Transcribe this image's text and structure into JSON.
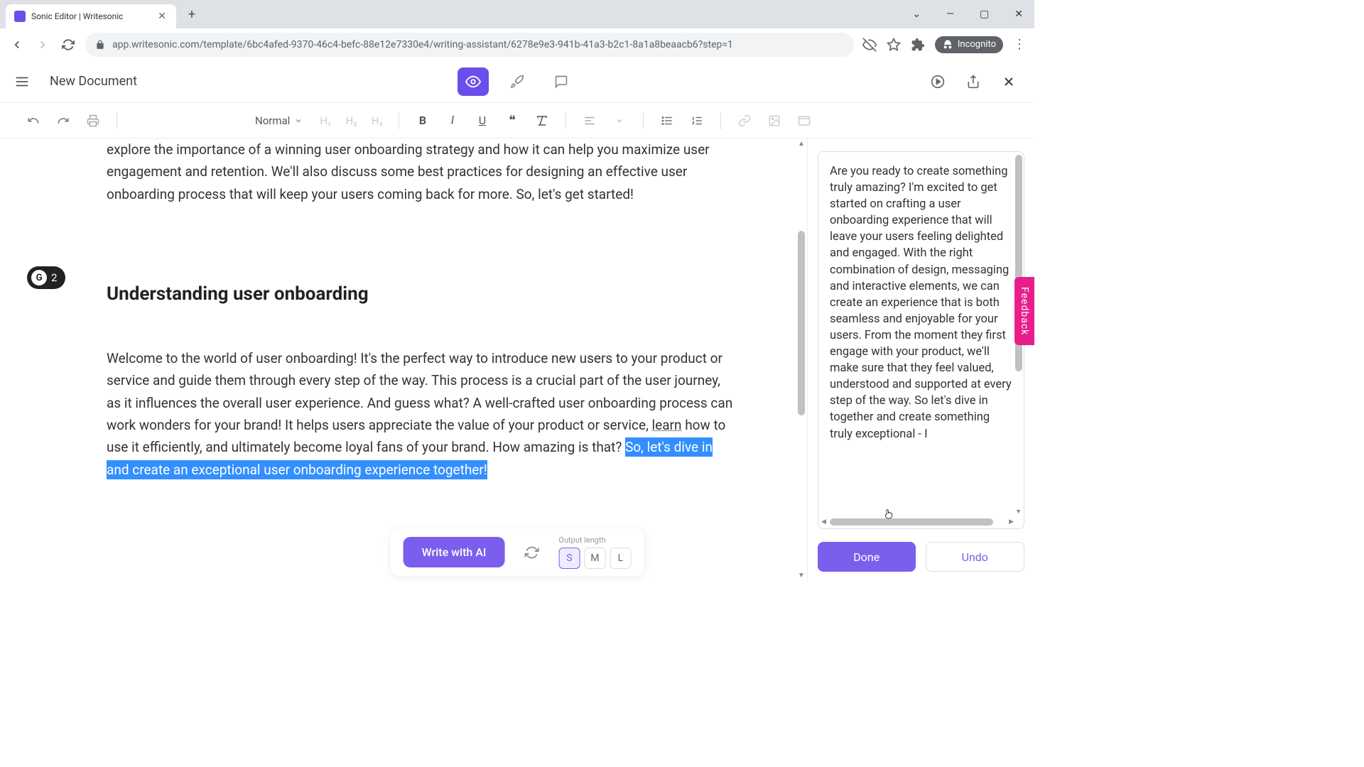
{
  "browser": {
    "tab_title": "Sonic Editor | Writesonic",
    "url": "app.writesonic.com/template/6bc4afed-9370-46c4-befc-88e12e7330e4/writing-assistant/6278e9e3-941b-41a3-b2c1-8a1a8beaacb6?step=1",
    "incognito_label": "Incognito"
  },
  "header": {
    "doc_title": "New Document"
  },
  "toolbar": {
    "style_select": "Normal",
    "h1": "H₁",
    "h2": "H₂",
    "h3": "H₃"
  },
  "editor": {
    "para1": "explore the importance of a winning user onboarding strategy and how it can help you maximize user engagement and retention. We'll also discuss some best practices for designing an effective user onboarding process that will keep your users coming back for more. So, let's get started!",
    "heading": "Understanding user onboarding",
    "para2_a": "Welcome to the world of user onboarding! It's the perfect way to introduce new users to your product or service and guide them through every step of the way. This process is a crucial part of the user journey, as it influences the overall user experience. And guess what? A well-crafted user onboarding process can work wonders for your brand! It helps users appreciate the value of your product or service, ",
    "para2_learn": "learn",
    "para2_b": " how to use it efficiently, and ultimately become loyal fans of your brand. How amazing is that? ",
    "para2_highlight": "So, let's dive in and create an exceptional user onboarding experience together!",
    "grammar_count": "2"
  },
  "side": {
    "text": "Are you ready to create something truly amazing? I'm excited to get started on crafting a user onboarding experience that will leave your users feeling delighted and engaged. With the right combination of design, messaging and interactive elements, we can create an experience that is both seamless and enjoyable for your users. From the moment they first engage with your product, we'll make sure that they feel valued, understood and supported at every step of the way. So let's dive in together and create something truly exceptional - I",
    "done_label": "Done",
    "undo_label": "Undo"
  },
  "bottom": {
    "write_ai": "Write with AI",
    "output_label": "Output length",
    "opts": {
      "s": "S",
      "m": "M",
      "l": "L"
    }
  },
  "feedback": "Feedback"
}
